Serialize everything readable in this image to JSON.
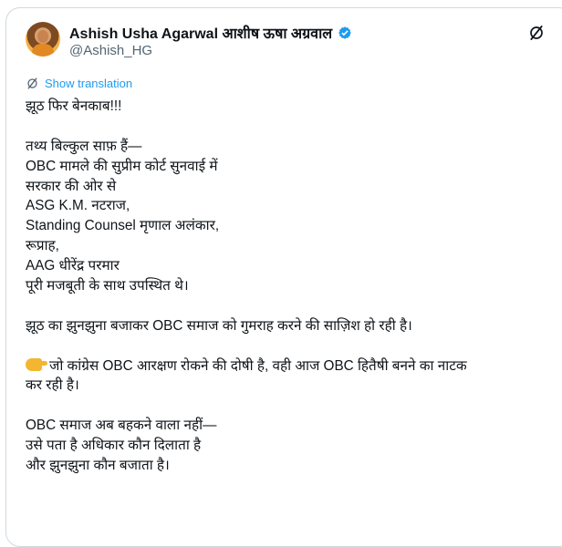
{
  "author": {
    "name": "Ashish Usha Agarwal आशीष ऊषा अग्रवाल",
    "handle": "@Ashish_HG"
  },
  "icons": {
    "avatar": "profile-photo",
    "verified": "verified-badge-icon",
    "grok": "grok-icon",
    "translate": "grok-translate-icon",
    "emoji": "backhand-index-pointing-right-emoji"
  },
  "colors": {
    "link": "#1d9bf0",
    "text": "#0f1419",
    "secondary": "#536471",
    "border": "#cfd9de"
  },
  "translate_label": "Show translation",
  "tweet": {
    "lines": [
      "झूठ फिर बेनकाब!!!",
      "",
      "तथ्य बिल्कुल साफ़ हैं—",
      "OBC मामले की सुप्रीम कोर्ट सुनवाई में",
      "सरकार की ओर से",
      "ASG K.M. नटराज,",
      "Standing Counsel मृणाल अलंकार,",
      "रूप्राह,",
      "AAG धीरेंद्र परमार",
      "पूरी मजबूती के साथ उपस्थित थे।",
      "",
      "झूठ का झुनझुना बजाकर OBC समाज को गुमराह करने की साज़िश हो रही है।",
      "",
      "जो कांग्रेस OBC आरक्षण रोकने की दोषी है, वही आज OBC हितैषी बनने का नाटक",
      "कर रही है।",
      "",
      "OBC समाज अब बहकने वाला नहीं—",
      "उसे पता है अधिकार कौन दिलाता है",
      "और झुनझुना कौन बजाता है।"
    ]
  }
}
